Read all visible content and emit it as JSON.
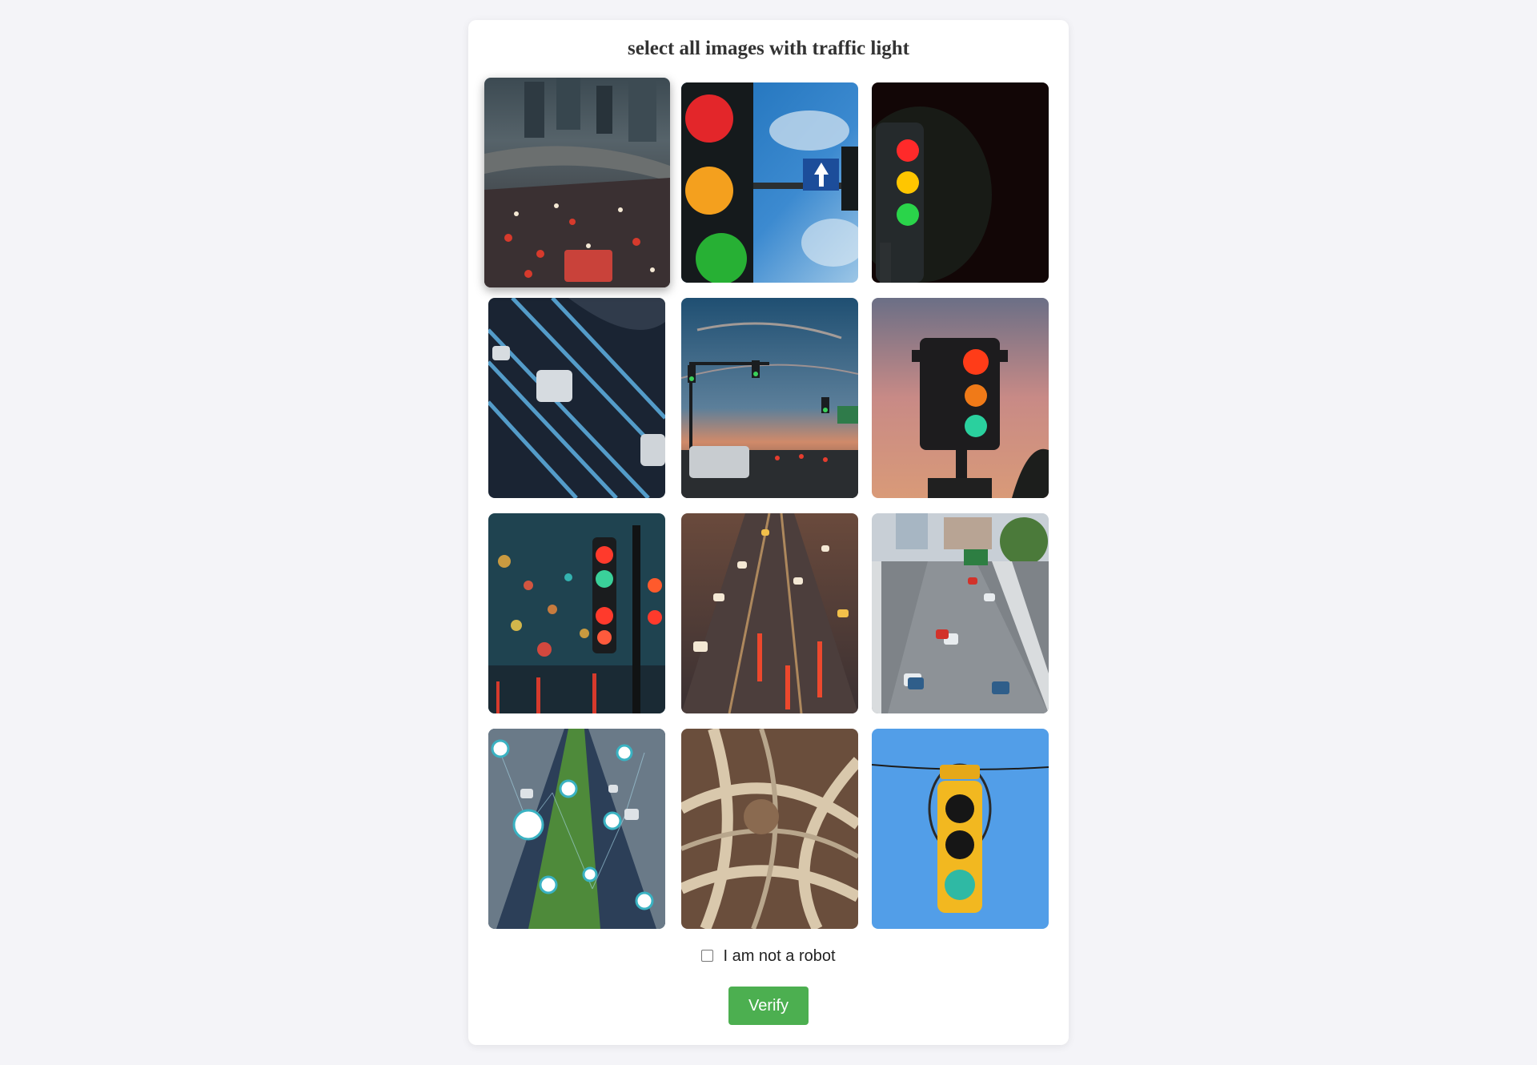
{
  "captcha": {
    "instruction": "select all images with traffic light",
    "checkbox_label": "I am not a robot",
    "verify_label": "Verify",
    "checkbox_checked": false,
    "hovered_tile": 1,
    "tiles": [
      {
        "index": 1,
        "scene": "congested-highway-city"
      },
      {
        "index": 2,
        "scene": "traffic-light-blue-sky"
      },
      {
        "index": 3,
        "scene": "traffic-light-dark"
      },
      {
        "index": 4,
        "scene": "digital-binary-highway"
      },
      {
        "index": 5,
        "scene": "intersection-sunset"
      },
      {
        "index": 6,
        "scene": "traffic-light-pink-sky"
      },
      {
        "index": 7,
        "scene": "traffic-light-rainy-night"
      },
      {
        "index": 8,
        "scene": "highway-motion-blur"
      },
      {
        "index": 9,
        "scene": "highway-aerial-cars"
      },
      {
        "index": 10,
        "scene": "smart-road-icons"
      },
      {
        "index": 11,
        "scene": "highway-interchange-aerial"
      },
      {
        "index": 12,
        "scene": "yellow-traffic-light-blue-sky"
      }
    ]
  },
  "colors": {
    "page_bg": "#f4f4f8",
    "card_bg": "#ffffff",
    "verify_button": "#4caf50",
    "title_text": "#333333"
  }
}
